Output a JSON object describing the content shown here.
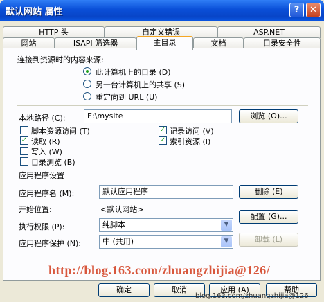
{
  "window": {
    "title": "默认网站 属性",
    "help": "?",
    "close": "✕"
  },
  "tabs_row1": [
    "HTTP 头",
    "自定义错误",
    "ASP.NET"
  ],
  "tabs_row2": [
    "网站",
    "ISAPI 筛选器",
    "主目录",
    "文档",
    "目录安全性"
  ],
  "content_source": {
    "heading": "连接到资源时的内容来源:",
    "options": [
      "此计算机上的目录 (D)",
      "另一台计算机上的共享 (S)",
      "重定向到 URL (U)"
    ]
  },
  "local_path": {
    "label": "本地路径 (C):",
    "value": "E:\\mysite",
    "browse": "浏览 (O)..."
  },
  "permissions": {
    "script_access": "脚本资源访问 (T)",
    "read": "读取 (R)",
    "write": "写入 (W)",
    "dir_browse": "目录浏览 (B)",
    "log_visits": "记录访问 (V)",
    "index": "索引资源 (I)"
  },
  "app_settings": {
    "heading": "应用程序设置",
    "app_name_label": "应用程序名 (M):",
    "app_name_value": "默认应用程序",
    "remove": "删除 (E)",
    "start_label": "开始位置:",
    "start_value": "<默认网站>",
    "config": "配置 (G)...",
    "exec_label": "执行权限 (P):",
    "exec_value": "纯脚本",
    "protect_label": "应用程序保护 (N):",
    "protect_value": "中 (共用)",
    "unload": "卸载 (L)"
  },
  "footer": {
    "ok": "确定",
    "cancel": "取消",
    "apply": "应用 (A)",
    "help": "帮助"
  },
  "watermark": "http://blog.163.com/zhuangzhijia@126/",
  "watermark_small": "blog.163.com/zhuangzhijia@126"
}
